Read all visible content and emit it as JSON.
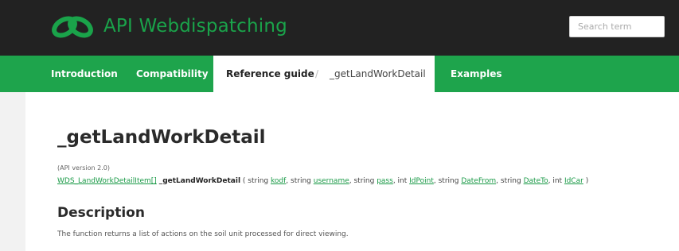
{
  "header": {
    "brand": "API Webdispatching",
    "search_placeholder": "Search term",
    "logo_icon": "infinity-link-logo-icon",
    "brand_color": "#1aa34a"
  },
  "nav": {
    "items": [
      "Introduction",
      "Compatibility",
      "Reference guide",
      "Examples"
    ],
    "separator": "/",
    "current": "_getLandWorkDetail",
    "bar_color": "#1ea44c"
  },
  "content": {
    "title": "_getLandWorkDetail",
    "version": "(API version 2.0)",
    "signature": {
      "return_type": "WDS_LandWorkDetailItem[]",
      "function": "_getLandWorkDetail",
      "open": "(",
      "close": ")",
      "params": [
        {
          "type": "string",
          "name": "kodf"
        },
        {
          "type": "string",
          "name": "username"
        },
        {
          "type": "string",
          "name": "pass"
        },
        {
          "type": "int",
          "name": "IdPoint"
        },
        {
          "type": "string",
          "name": "DateFrom"
        },
        {
          "type": "string",
          "name": "DateTo"
        },
        {
          "type": "int",
          "name": "IdCar"
        }
      ]
    },
    "description_heading": "Description",
    "description": "The function returns a list of actions on the soil unit processed for direct viewing."
  }
}
